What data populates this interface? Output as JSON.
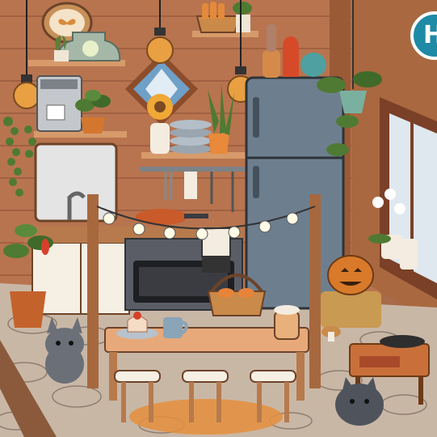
{
  "app": {
    "help_button_glyph": "H",
    "help_button_label": "help-icon"
  },
  "colors": {
    "wall": "#b8744f",
    "wall_plank_line": "#8f5237",
    "floor": "#c9b7a6",
    "floor_stone_line": "#8f7d70",
    "fridge": "#6d7f8f",
    "stove": "#5a5d66",
    "counter": "#f6efe4",
    "wood": "#b77a4c",
    "accent_teal": "#1f8aa6"
  },
  "scene_items": [
    "butterfly-frame",
    "glass-jar",
    "pendant-lamp",
    "espresso-machine",
    "hanging-vine",
    "bread-basket",
    "diamond-window",
    "sunflower-vase",
    "plate-stack",
    "snake-plant",
    "refrigerator",
    "oil-lamp",
    "vase-trio",
    "hanging-plant",
    "kitchen-window",
    "orchid",
    "stove",
    "frying-pan",
    "utensil-rack",
    "string-lights",
    "dining-table",
    "cake-slice",
    "coffee-mug",
    "latte-glass",
    "bread-bowl",
    "pumpkin",
    "hay-bale",
    "record-player",
    "gray-cat",
    "gray-pomeranian",
    "potted-tomato-plant",
    "bar-stools",
    "chef-apron"
  ]
}
